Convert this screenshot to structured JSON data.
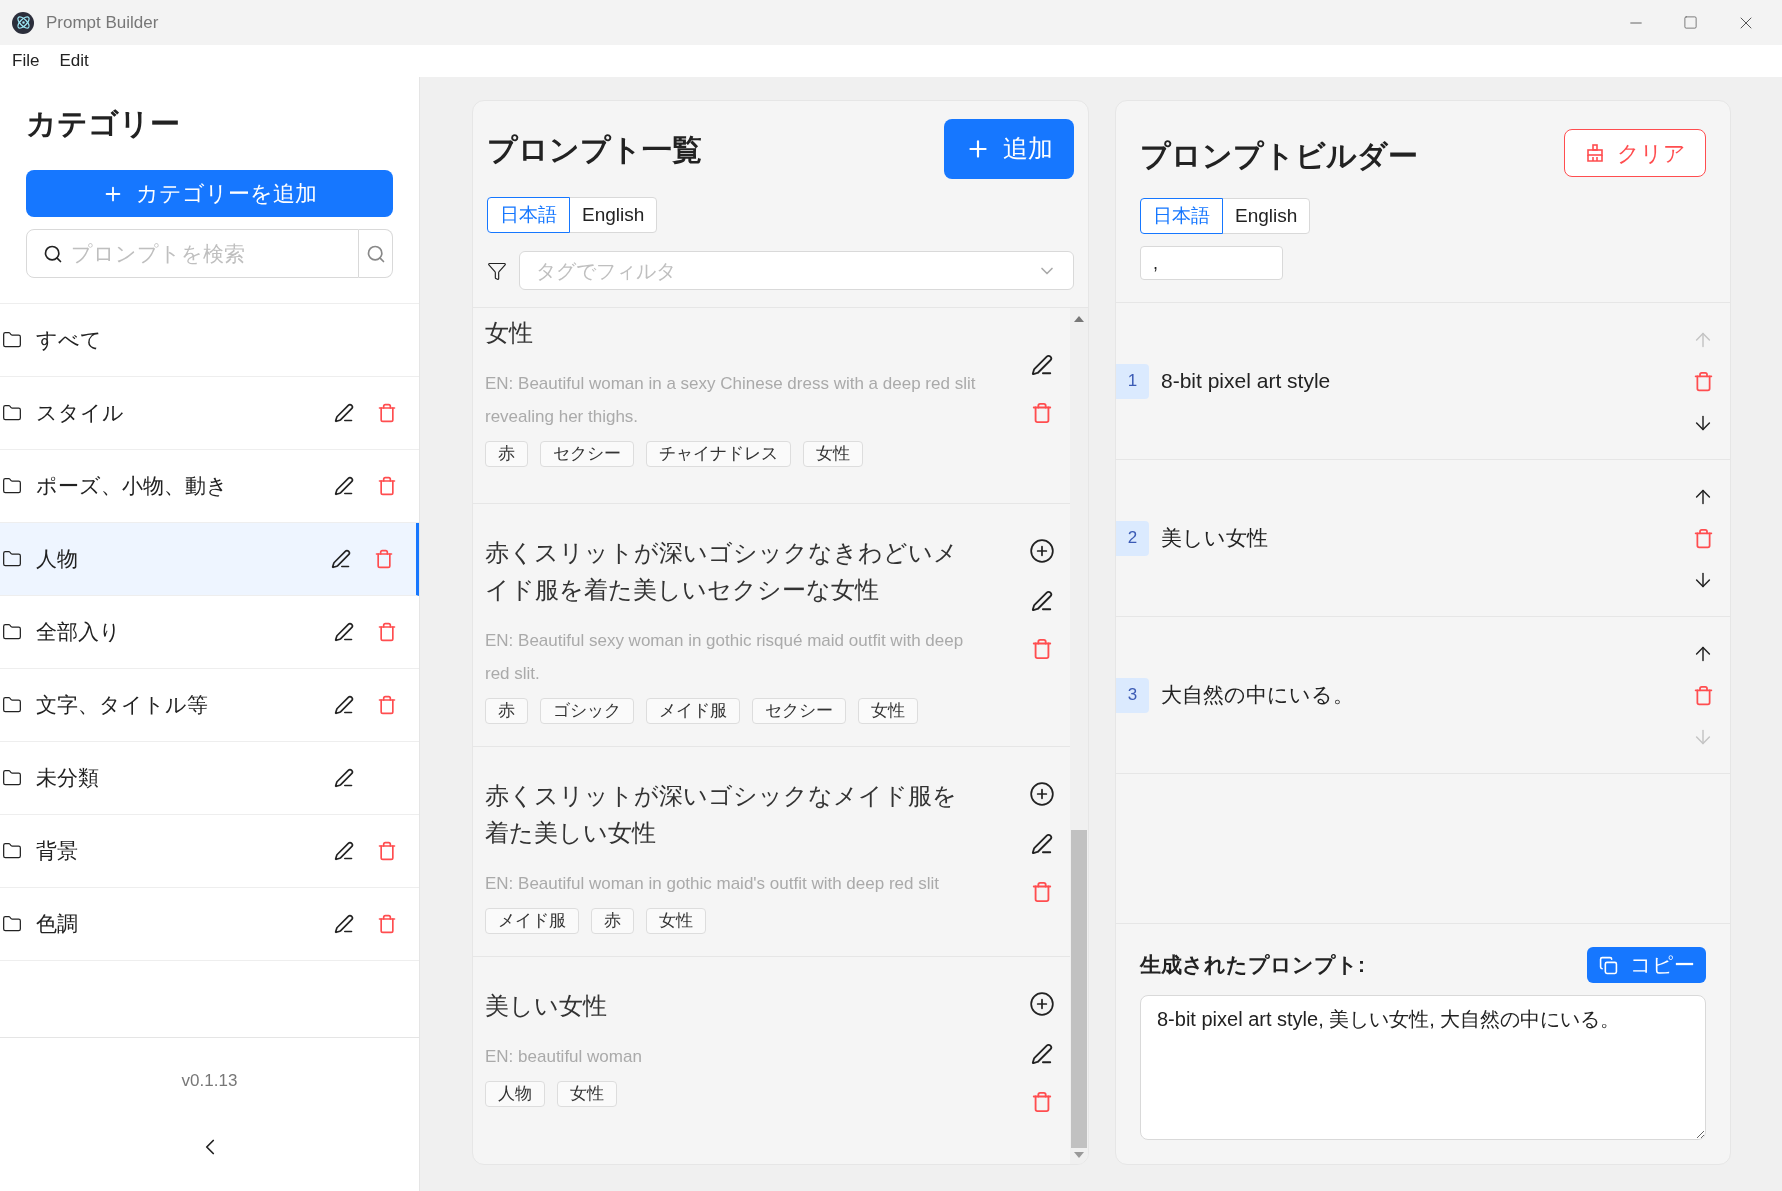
{
  "window": {
    "title": "Prompt Builder"
  },
  "menu": [
    "File",
    "Edit"
  ],
  "sidebar": {
    "heading": "カテゴリー",
    "add_button": "カテゴリーを追加",
    "search": {
      "placeholder": "プロンプトを検索"
    },
    "categories": [
      {
        "name": "すべて",
        "editable": false,
        "deletable": false,
        "selected": false
      },
      {
        "name": "スタイル",
        "editable": true,
        "deletable": true,
        "selected": false
      },
      {
        "name": "ポーズ、小物、動き",
        "editable": true,
        "deletable": true,
        "selected": false
      },
      {
        "name": "人物",
        "editable": true,
        "deletable": true,
        "selected": true
      },
      {
        "name": "全部入り",
        "editable": true,
        "deletable": true,
        "selected": false
      },
      {
        "name": "文字、タイトル等",
        "editable": true,
        "deletable": true,
        "selected": false
      },
      {
        "name": "未分類",
        "editable": true,
        "deletable": false,
        "selected": false
      },
      {
        "name": "背景",
        "editable": true,
        "deletable": true,
        "selected": false
      },
      {
        "name": "色調",
        "editable": true,
        "deletable": true,
        "selected": false
      }
    ],
    "version": "v0.1.13"
  },
  "prompt_list": {
    "title": "プロンプト一覧",
    "add_button": "追加",
    "language_tabs": [
      {
        "label": "日本語",
        "selected": true
      },
      {
        "label": "English",
        "selected": false
      }
    ],
    "filter": {
      "placeholder": "タグでフィルタ"
    },
    "items": [
      {
        "title": "女性",
        "en": "EN: Beautiful woman in a sexy Chinese dress with a deep red slit revealing her thighs.",
        "tags": [
          "赤",
          "セクシー",
          "チャイナドレス",
          "女性"
        ],
        "cut": true
      },
      {
        "title": "赤くスリットが深いゴシックなきわどいメイド服を着た美しいセクシーな女性",
        "en": "EN: Beautiful sexy woman in gothic risqué maid outfit with deep red slit.",
        "tags": [
          "赤",
          "ゴシック",
          "メイド服",
          "セクシー",
          "女性"
        ],
        "cut": false
      },
      {
        "title": "赤くスリットが深いゴシックなメイド服を着た美しい女性",
        "en": "EN: Beautiful woman in gothic maid's outfit with deep red slit",
        "tags": [
          "メイド服",
          "赤",
          "女性"
        ],
        "cut": false
      },
      {
        "title": "美しい女性",
        "en": "EN: beautiful woman",
        "tags": [
          "人物",
          "女性"
        ],
        "cut": false
      }
    ]
  },
  "builder": {
    "title": "プロンプトビルダー",
    "clear_button": "クリア",
    "language_tabs": [
      {
        "label": "日本語",
        "selected": true
      },
      {
        "label": "English",
        "selected": false
      }
    ],
    "separator_field": {
      "value": ","
    },
    "items": [
      {
        "index": "1",
        "text": "8-bit pixel art style",
        "can_move_up": false,
        "can_move_down": true
      },
      {
        "index": "2",
        "text": "美しい女性",
        "can_move_up": true,
        "can_move_down": true
      },
      {
        "index": "3",
        "text": "大自然の中にいる。",
        "can_move_up": true,
        "can_move_down": false
      }
    ],
    "output": {
      "label": "生成されたプロンプト:",
      "copy_button": "コピー",
      "value": "8-bit pixel art style, 美しい女性, 大自然の中にいる。"
    }
  }
}
